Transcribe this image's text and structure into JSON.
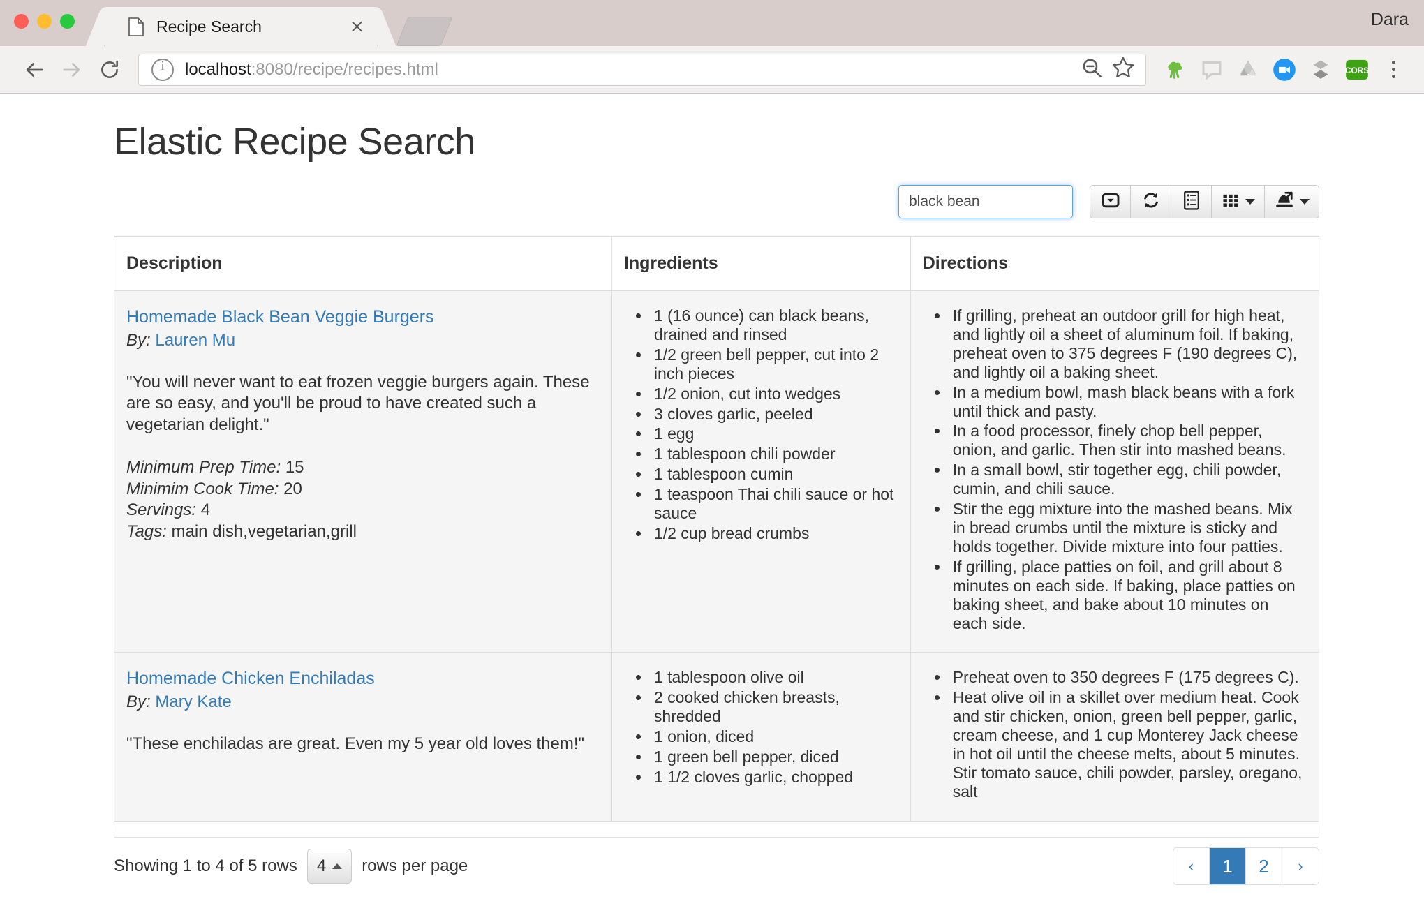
{
  "browser": {
    "tab": {
      "title": "Recipe Search",
      "favicon_icon": "document-icon",
      "close_icon": "close-icon"
    },
    "profile_name": "Dara",
    "nav": {
      "back_icon": "back-arrow-icon",
      "forward_icon": "forward-arrow-icon",
      "reload_icon": "reload-icon"
    },
    "omnibox": {
      "info_icon": "info-circle-icon",
      "url_host": "localhost",
      "url_rest": ":8080/recipe/recipes.html",
      "zoom_icon": "zoom-out-icon",
      "bookmark_icon": "star-icon"
    },
    "extensions": [
      {
        "name": "broccoli-extension-icon",
        "color": "#6fbf3f"
      },
      {
        "name": "speech-bubble-extension-icon",
        "color": "#cfcfcf"
      },
      {
        "name": "google-drive-extension-icon",
        "color": "#b8b8b8"
      },
      {
        "name": "video-camera-extension-icon",
        "color": "#2196f3"
      },
      {
        "name": "layers-extension-icon",
        "color": "#9a9a9a"
      },
      {
        "name": "cors-extension-icon",
        "color": "#3ea312",
        "label": "CORS"
      }
    ],
    "menu_icon": "kebab-menu-icon"
  },
  "page": {
    "title": "Elastic Recipe Search",
    "toolbar": {
      "search": {
        "value": "black bean",
        "placeholder": ""
      },
      "buttons": [
        {
          "name": "paginate-toggle-button",
          "icon": "boxed-caret-down-icon",
          "label": ""
        },
        {
          "name": "refresh-button",
          "icon": "refresh-icon",
          "label": ""
        },
        {
          "name": "toggle-detail-view-button",
          "icon": "list-detail-icon",
          "label": ""
        },
        {
          "name": "columns-dropdown-button",
          "icon": "grid-icon",
          "label": "",
          "has_caret": true
        },
        {
          "name": "export-dropdown-button",
          "icon": "export-icon",
          "label": "",
          "has_caret": true
        }
      ]
    },
    "table": {
      "columns": [
        "Description",
        "Ingredients",
        "Directions"
      ],
      "rows": [
        {
          "title": "Homemade Black Bean Veggie Burgers",
          "by_label": "By:",
          "author": "Lauren Mu",
          "quote": "\"You will never want to eat frozen veggie burgers again. These are so easy, and you'll be proud to have created such a vegetarian delight.\"",
          "meta": [
            {
              "label": "Minimum Prep Time:",
              "value": "15"
            },
            {
              "label": "Minimim Cook Time:",
              "value": "20"
            },
            {
              "label": "Servings:",
              "value": "4"
            },
            {
              "label": "Tags:",
              "value": "main dish,vegetarian,grill"
            }
          ],
          "ingredients": [
            "1 (16 ounce) can black beans, drained and rinsed",
            "1/2 green bell pepper, cut into 2 inch pieces",
            "1/2 onion, cut into wedges",
            "3 cloves garlic, peeled",
            "1 egg",
            "1 tablespoon chili powder",
            "1 tablespoon cumin",
            "1 teaspoon Thai chili sauce or hot sauce",
            "1/2 cup bread crumbs"
          ],
          "directions": [
            "If grilling, preheat an outdoor grill for high heat, and lightly oil a sheet of aluminum foil. If baking, preheat oven to 375 degrees F (190 degrees C), and lightly oil a baking sheet.",
            "In a medium bowl, mash black beans with a fork until thick and pasty.",
            "In a food processor, finely chop bell pepper, onion, and garlic. Then stir into mashed beans.",
            "In a small bowl, stir together egg, chili powder, cumin, and chili sauce.",
            "Stir the egg mixture into the mashed beans. Mix in bread crumbs until the mixture is sticky and holds together. Divide mixture into four patties.",
            "If grilling, place patties on foil, and grill about 8 minutes on each side. If baking, place patties on baking sheet, and bake about 10 minutes on each side."
          ]
        },
        {
          "title": "Homemade Chicken Enchiladas",
          "by_label": "By:",
          "author": "Mary Kate",
          "quote": "\"These enchiladas are great. Even my 5 year old loves them!\"",
          "meta": [],
          "ingredients": [
            "1 tablespoon olive oil",
            "2 cooked chicken breasts, shredded",
            "1 onion, diced",
            "1 green bell pepper, diced",
            "1 1/2 cloves garlic, chopped"
          ],
          "directions": [
            "Preheat oven to 350 degrees F (175 degrees C).",
            "Heat olive oil in a skillet over medium heat. Cook and stir chicken, onion, green bell pepper, garlic, cream cheese, and 1 cup Monterey Jack cheese in hot oil until the cheese melts, about 5 minutes. Stir tomato sauce, chili powder, parsley, oregano, salt"
          ]
        }
      ]
    },
    "footer": {
      "showing_text": "Showing 1 to 4 of 5 rows",
      "page_size": "4",
      "rows_per_page_label": "rows per page",
      "pagination": {
        "prev": "‹",
        "pages": [
          "1",
          "2"
        ],
        "active": "1",
        "next": "›"
      }
    }
  },
  "colors": {
    "link": "#337ab7",
    "active_page": "#337ab7",
    "search_focus": "#5aa3e8",
    "row_bg": "#f5f5f5"
  }
}
